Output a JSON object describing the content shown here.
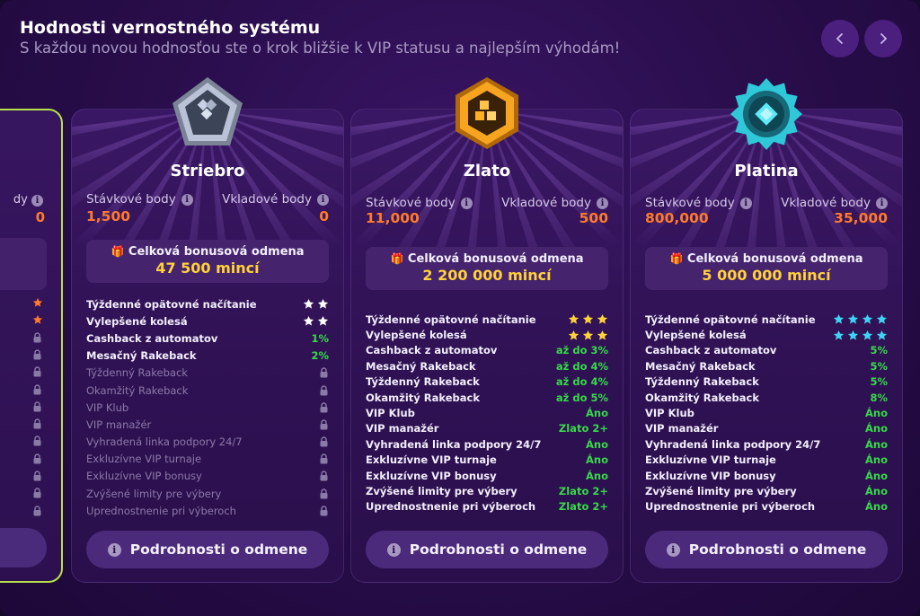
{
  "header": {
    "title": "Hodnosti vernostného systému",
    "subtitle": "S každou novou hodnosťou ste o krok bližšie k VIP statusu a najlepším výhodám!"
  },
  "nav": {
    "prev_icon": "chevron-left-icon",
    "next_icon": "chevron-right-icon"
  },
  "partial_card": {
    "label": "dy",
    "value": "0"
  },
  "cards": [
    {
      "name": "Striebro",
      "badge_color": "#b9c2d6",
      "stake_label": "Stávkové body",
      "stake_value": "1,500",
      "deposit_label": "Vkladové body",
      "deposit_value": "0",
      "bonus_label": "Celková bonusová odmena",
      "bonus_amount": "47 500 mincí",
      "button_label": "Podrobnosti o odmene",
      "features": [
        {
          "label": "Týždenné opätovné načítanie",
          "stars": 2,
          "star_color": "#ffffff",
          "locked": false
        },
        {
          "label": "Vylepšené kolesá",
          "stars": 2,
          "star_color": "#ffffff",
          "locked": false
        },
        {
          "label": "Cashback z automatov",
          "value": "1%",
          "locked": false
        },
        {
          "label": "Mesačný Rakeback",
          "value": "2%",
          "locked": false
        },
        {
          "label": "Týždenný Rakeback",
          "locked": true
        },
        {
          "label": "Okamžitý Rakeback",
          "locked": true
        },
        {
          "label": "VIP Klub",
          "locked": true
        },
        {
          "label": "VIP manažér",
          "locked": true
        },
        {
          "label": "Vyhradená linka podpory 24/7",
          "locked": true
        },
        {
          "label": "Exkluzívne VIP turnaje",
          "locked": true
        },
        {
          "label": "Exkluzívne VIP bonusy",
          "locked": true
        },
        {
          "label": "Zvýšené limity pre výbery",
          "locked": true
        },
        {
          "label": "Uprednostnenie pri výberoch",
          "locked": true
        }
      ]
    },
    {
      "name": "Zlato",
      "badge_color": "#f7a520",
      "stake_label": "Stávkové body",
      "stake_value": "11,000",
      "deposit_label": "Vkladové body",
      "deposit_value": "500",
      "bonus_label": "Celková bonusová odmena",
      "bonus_amount": "2 200 000 mincí",
      "button_label": "Podrobnosti o odmene",
      "features": [
        {
          "label": "Týždenné opätovné načítanie",
          "stars": 3,
          "star_color": "#ffd23a",
          "locked": false
        },
        {
          "label": "Vylepšené kolesá",
          "stars": 3,
          "star_color": "#ffd23a",
          "locked": false
        },
        {
          "label": "Cashback z automatov",
          "value": "až do 3%",
          "locked": false
        },
        {
          "label": "Mesačný Rakeback",
          "value": "až do 4%",
          "locked": false
        },
        {
          "label": "Týždenný Rakeback",
          "value": "až do 4%",
          "locked": false
        },
        {
          "label": "Okamžitý Rakeback",
          "value": "až do 5%",
          "locked": false
        },
        {
          "label": "VIP Klub",
          "value": "Áno",
          "locked": false
        },
        {
          "label": "VIP manažér",
          "value": "Zlato 2+",
          "locked": false
        },
        {
          "label": "Vyhradená linka podpory 24/7",
          "value": "Áno",
          "locked": false
        },
        {
          "label": "Exkluzívne VIP turnaje",
          "value": "Áno",
          "locked": false
        },
        {
          "label": "Exkluzívne VIP bonusy",
          "value": "Áno",
          "locked": false
        },
        {
          "label": "Zvýšené limity pre výbery",
          "value": "Zlato 2+",
          "locked": false
        },
        {
          "label": "Uprednostnenie pri výberoch",
          "value": "Zlato 2+",
          "locked": false
        }
      ]
    },
    {
      "name": "Platina",
      "badge_color": "#2ec8d8",
      "stake_label": "Stávkové body",
      "stake_value": "800,000",
      "deposit_label": "Vkladové body",
      "deposit_value": "35,000",
      "bonus_label": "Celková bonusová odmena",
      "bonus_amount": "5 000 000 mincí",
      "button_label": "Podrobnosti o odmene",
      "features": [
        {
          "label": "Týždenné opätovné načítanie",
          "stars": 4,
          "star_color": "#3fd3f0",
          "locked": false
        },
        {
          "label": "Vylepšené kolesá",
          "stars": 4,
          "star_color": "#3fd3f0",
          "locked": false
        },
        {
          "label": "Cashback z automatov",
          "value": "5%",
          "locked": false
        },
        {
          "label": "Mesačný Rakeback",
          "value": "5%",
          "locked": false
        },
        {
          "label": "Týždenný Rakeback",
          "value": "5%",
          "locked": false
        },
        {
          "label": "Okamžitý Rakeback",
          "value": "8%",
          "locked": false
        },
        {
          "label": "VIP Klub",
          "value": "Áno",
          "locked": false
        },
        {
          "label": "VIP manažér",
          "value": "Áno",
          "locked": false
        },
        {
          "label": "Vyhradená linka podpory 24/7",
          "value": "Áno",
          "locked": false
        },
        {
          "label": "Exkluzívne VIP turnaje",
          "value": "Áno",
          "locked": false
        },
        {
          "label": "Exkluzívne VIP bonusy",
          "value": "Áno",
          "locked": false
        },
        {
          "label": "Zvýšené limity pre výbery",
          "value": "Áno",
          "locked": false
        },
        {
          "label": "Uprednostnenie pri výberoch",
          "value": "Áno",
          "locked": false
        }
      ]
    }
  ],
  "colors": {
    "accent_orange": "#ff7a2a",
    "accent_yellow": "#ffd23a",
    "accent_green": "#37d94a",
    "current_rank_border": "#b8e04a"
  }
}
